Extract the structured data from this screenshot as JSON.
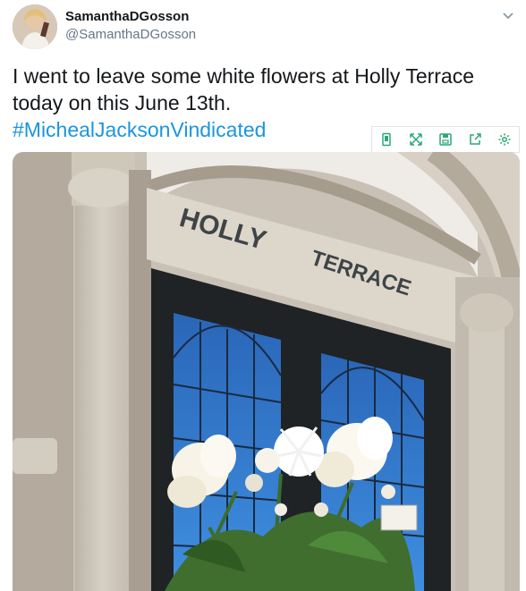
{
  "tweet": {
    "display_name": "SamanthaDGosson",
    "handle": "@SamanthaDGosson",
    "text_line1": "I went to leave some white flowers at Holly Terrace",
    "text_line2": "today on this June 13th.",
    "hashtag": "#MichealJacksonVindicated"
  },
  "photo": {
    "sign_word1": "HOLLY",
    "sign_word2": "TERRACE"
  },
  "toolbar": {
    "icons": [
      "phone-icon",
      "expand-icon",
      "save-icon",
      "share-icon",
      "settings-icon"
    ]
  },
  "colors": {
    "hashtag": "#1b95e0",
    "handle": "#657786",
    "toolbar_icon": "#2aa876"
  }
}
